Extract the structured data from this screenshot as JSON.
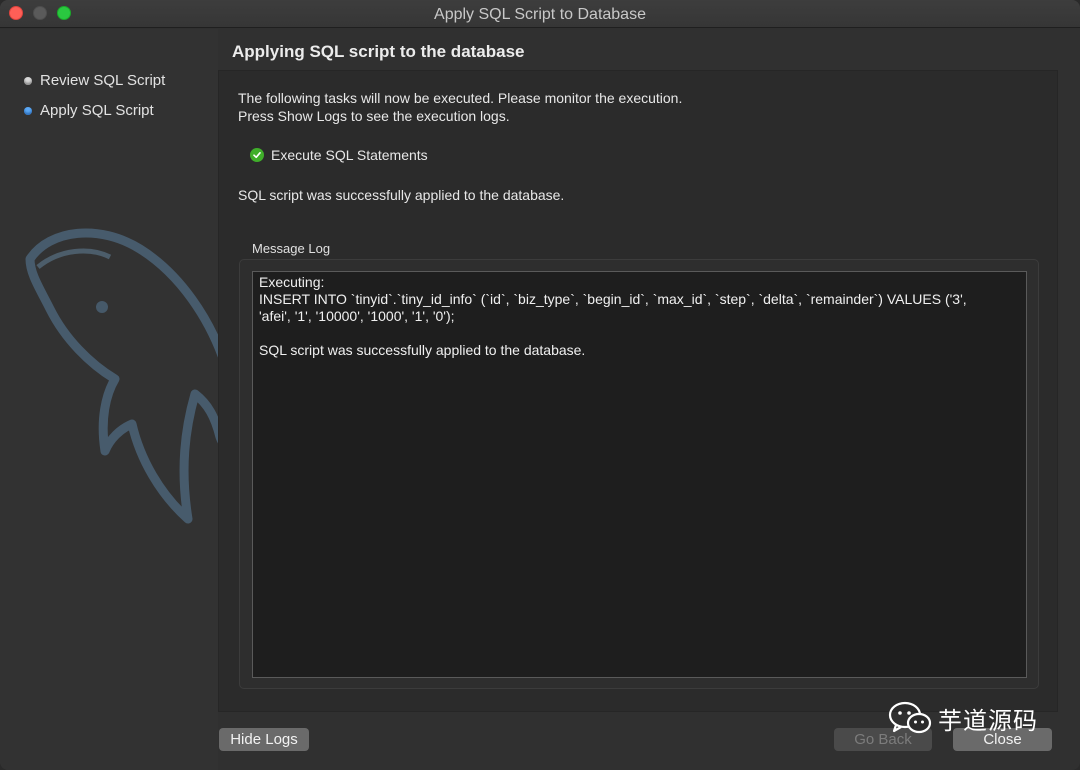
{
  "window": {
    "title": "Apply SQL Script to Database"
  },
  "sidebar": {
    "items": [
      {
        "label": "Review SQL Script",
        "state": "done"
      },
      {
        "label": "Apply SQL Script",
        "state": "active"
      }
    ]
  },
  "page": {
    "heading": "Applying SQL script to the database",
    "intro_line_1": "The following tasks will now be executed. Please monitor the execution.",
    "intro_line_2": "Press Show Logs to see the execution logs.",
    "task_label": "Execute SQL Statements",
    "success_message": "SQL script was successfully applied to the database."
  },
  "message_log": {
    "label": "Message Log",
    "lines": [
      "Executing:",
      "INSERT INTO `tinyid`.`tiny_id_info` (`id`, `biz_type`, `begin_id`, `max_id`, `step`, `delta`, `remainder`) VALUES ('3',",
      "'afei', '1', '10000', '1000', '1', '0');",
      "",
      "SQL script was successfully applied to the database."
    ]
  },
  "buttons": {
    "hide_logs": "Hide Logs",
    "go_back": "Go Back",
    "close": "Close"
  },
  "watermark": {
    "text": "芋道源码"
  },
  "colors": {
    "accent_active": "#5ba8f5",
    "success": "#3fae2a",
    "close_traffic": "#fe5f57",
    "max_traffic": "#2ac840"
  }
}
